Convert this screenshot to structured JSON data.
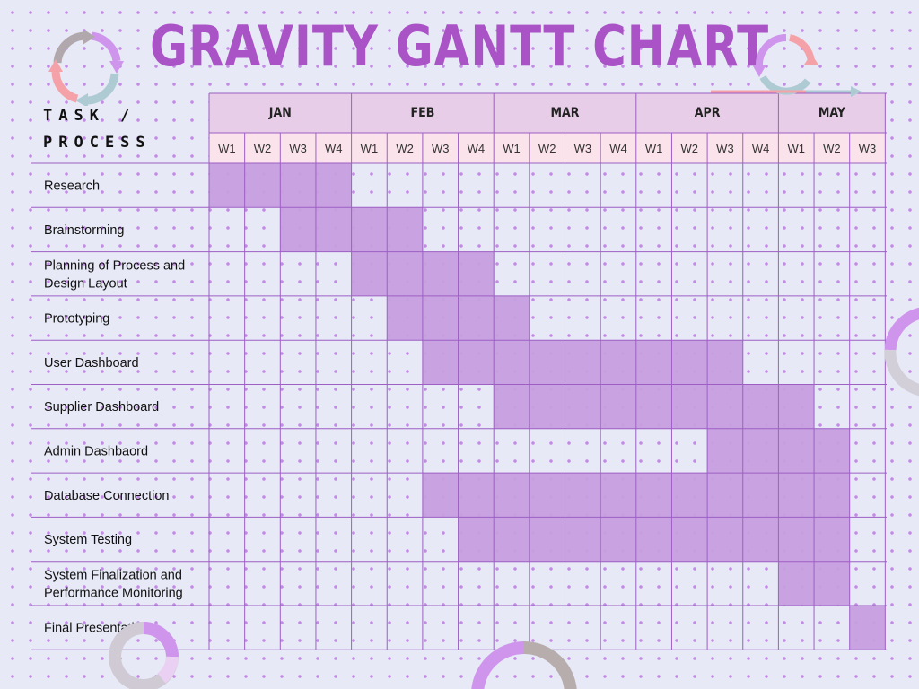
{
  "title": "GRAVITY GANTT CHART",
  "corner_label": {
    "line1": "TASK /",
    "line2": "PROCESS"
  },
  "colors": {
    "title": "#a953c6",
    "month_header": "#e7cde8",
    "week_header": "#fbe3ec",
    "bar": "#c79fdf",
    "grid_line": "#9d5fc4"
  },
  "chart_data": {
    "type": "gantt",
    "title": "GRAVITY GANTT CHART",
    "row_header": "TASK / PROCESS",
    "months": [
      {
        "name": "JAN",
        "weeks": [
          "W1",
          "W2",
          "W3",
          "W4"
        ]
      },
      {
        "name": "FEB",
        "weeks": [
          "W1",
          "W2",
          "W3",
          "W4"
        ]
      },
      {
        "name": "MAR",
        "weeks": [
          "W1",
          "W2",
          "W3",
          "W4"
        ]
      },
      {
        "name": "APR",
        "weeks": [
          "W1",
          "W2",
          "W3",
          "W4"
        ]
      },
      {
        "name": "MAY",
        "weeks": [
          "W1",
          "W2",
          "W3"
        ]
      }
    ],
    "tasks": [
      {
        "name": "Research",
        "start": "JAN W1",
        "end": "JAN W4"
      },
      {
        "name": "Brainstorming",
        "start": "JAN W3",
        "end": "FEB W2"
      },
      {
        "name": "Planning of Process and\nDesign Layout",
        "start": "FEB W1",
        "end": "FEB W4"
      },
      {
        "name": "Prototyping",
        "start": "FEB W2",
        "end": "MAR W1"
      },
      {
        "name": "User Dashboard",
        "start": "FEB W3",
        "end": "APR W3"
      },
      {
        "name": "Supplier Dashboard",
        "start": "MAR W1",
        "end": "MAY W1"
      },
      {
        "name": "Admin Dashbaord",
        "start": "APR W3",
        "end": "MAY W2"
      },
      {
        "name": "Database Connection",
        "start": "FEB W3",
        "end": "MAY W2"
      },
      {
        "name": "System Testing",
        "start": "FEB W4",
        "end": "MAY W2"
      },
      {
        "name": "System Finalization and\nPerformance Monitoring",
        "start": "MAY W1",
        "end": "MAY W2"
      },
      {
        "name": "Final Presentation",
        "start": "MAY W3",
        "end": "MAY W3"
      }
    ]
  }
}
